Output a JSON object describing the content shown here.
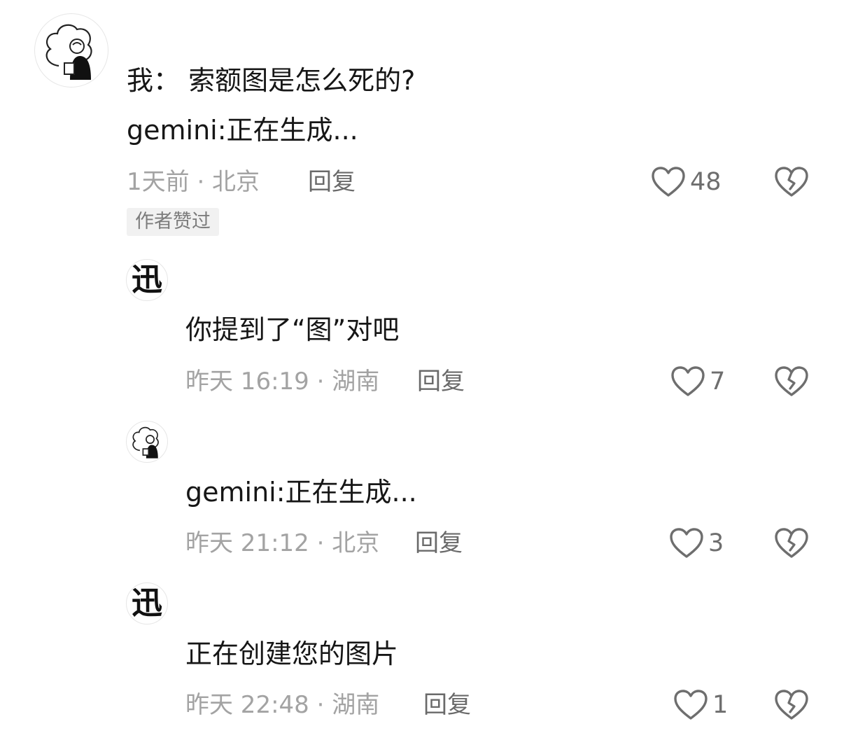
{
  "comments": [
    {
      "avatar": "sketch-avatar",
      "text_lines": [
        "我：  索额图是怎么死的?",
        "gemini:正在生成..."
      ],
      "meta": "1天前 · 北京",
      "reply_label": "回复",
      "likes": "48",
      "badge": "作者赞过"
    },
    {
      "avatar_char": "迅",
      "text_lines": [
        "你提到了“图”对吧"
      ],
      "meta": "昨天 16:19 · 湖南",
      "reply_label": "回复",
      "likes": "7"
    },
    {
      "avatar": "sketch-avatar",
      "text_lines": [
        "gemini:正在生成..."
      ],
      "meta": "昨天 21:12 · 北京",
      "reply_label": "回复",
      "likes": "3"
    },
    {
      "avatar_char": "迅",
      "text_lines": [
        "正在创建您的图片"
      ],
      "meta": "昨天 22:48 · 湖南",
      "reply_label": "回复",
      "likes": "1"
    }
  ],
  "icons": {
    "like": "heart-outline-icon",
    "dislike": "broken-heart-icon"
  },
  "colors": {
    "text": "#161616",
    "meta": "#a3a3a3",
    "icon": "#6e6e6e"
  }
}
